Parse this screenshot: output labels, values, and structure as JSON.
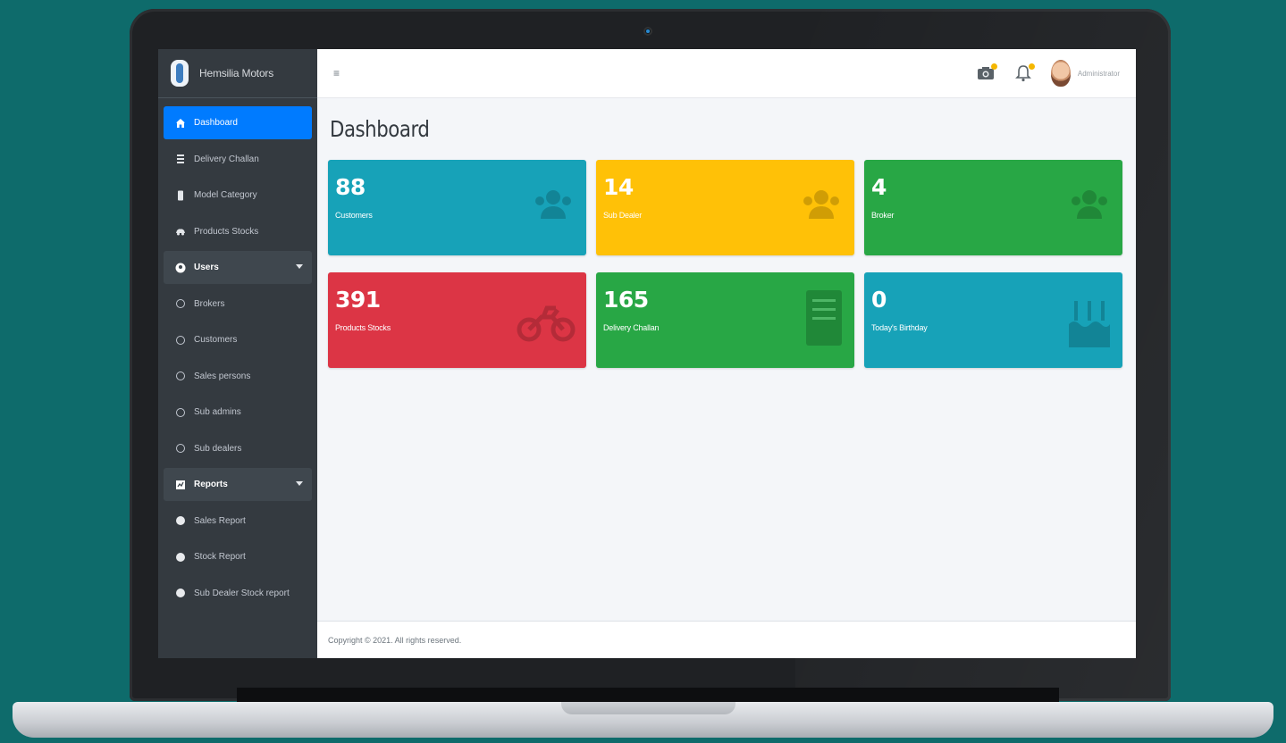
{
  "brand": {
    "name": "Hemsilia Motors"
  },
  "sidebar": {
    "items": [
      {
        "label": "Dashboard",
        "icon": "home-icon",
        "active": true
      },
      {
        "label": "Delivery Challan",
        "icon": "list-icon"
      },
      {
        "label": "Model Category",
        "icon": "file-icon"
      },
      {
        "label": "Products Stocks",
        "icon": "car-icon"
      },
      {
        "label": "Users",
        "icon": "user-circle-icon",
        "group": true
      },
      {
        "label": "Brokers",
        "icon": "circle-icon"
      },
      {
        "label": "Customers",
        "icon": "circle-icon"
      },
      {
        "label": "Sales persons",
        "icon": "circle-icon"
      },
      {
        "label": "Sub admins",
        "icon": "circle-icon"
      },
      {
        "label": "Sub dealers",
        "icon": "circle-icon"
      },
      {
        "label": "Reports",
        "icon": "report-icon",
        "group": true
      },
      {
        "label": "Sales Report",
        "icon": "dot-icon"
      },
      {
        "label": "Stock Report",
        "icon": "dot-icon"
      },
      {
        "label": "Sub Dealer Stock report",
        "icon": "dot-icon"
      }
    ]
  },
  "header": {
    "menu_icon": "≡",
    "user_name": "Administrator"
  },
  "page": {
    "title": "Dashboard"
  },
  "cards": [
    {
      "value": "88",
      "label": "Customers",
      "color": "#17a2b8",
      "icon": "users-icon"
    },
    {
      "value": "14",
      "label": "Sub Dealer",
      "color": "#ffc107",
      "icon": "users-icon"
    },
    {
      "value": "4",
      "label": "Broker",
      "color": "#28a745",
      "icon": "users-icon"
    },
    {
      "value": "391",
      "label": "Products Stocks",
      "color": "#dc3545",
      "icon": "motorcycle-icon"
    },
    {
      "value": "165",
      "label": "Delivery Challan",
      "color": "#28a745",
      "icon": "document-icon"
    },
    {
      "value": "0",
      "label": "Today's Birthday",
      "color": "#17a2b8",
      "icon": "birthday-cake-icon"
    }
  ],
  "footer": {
    "text": "Copyright © 2021. All rights reserved."
  },
  "colors": {
    "sidebar_bg": "#343a40",
    "active": "#007bff",
    "background": "#0e6b6b"
  }
}
